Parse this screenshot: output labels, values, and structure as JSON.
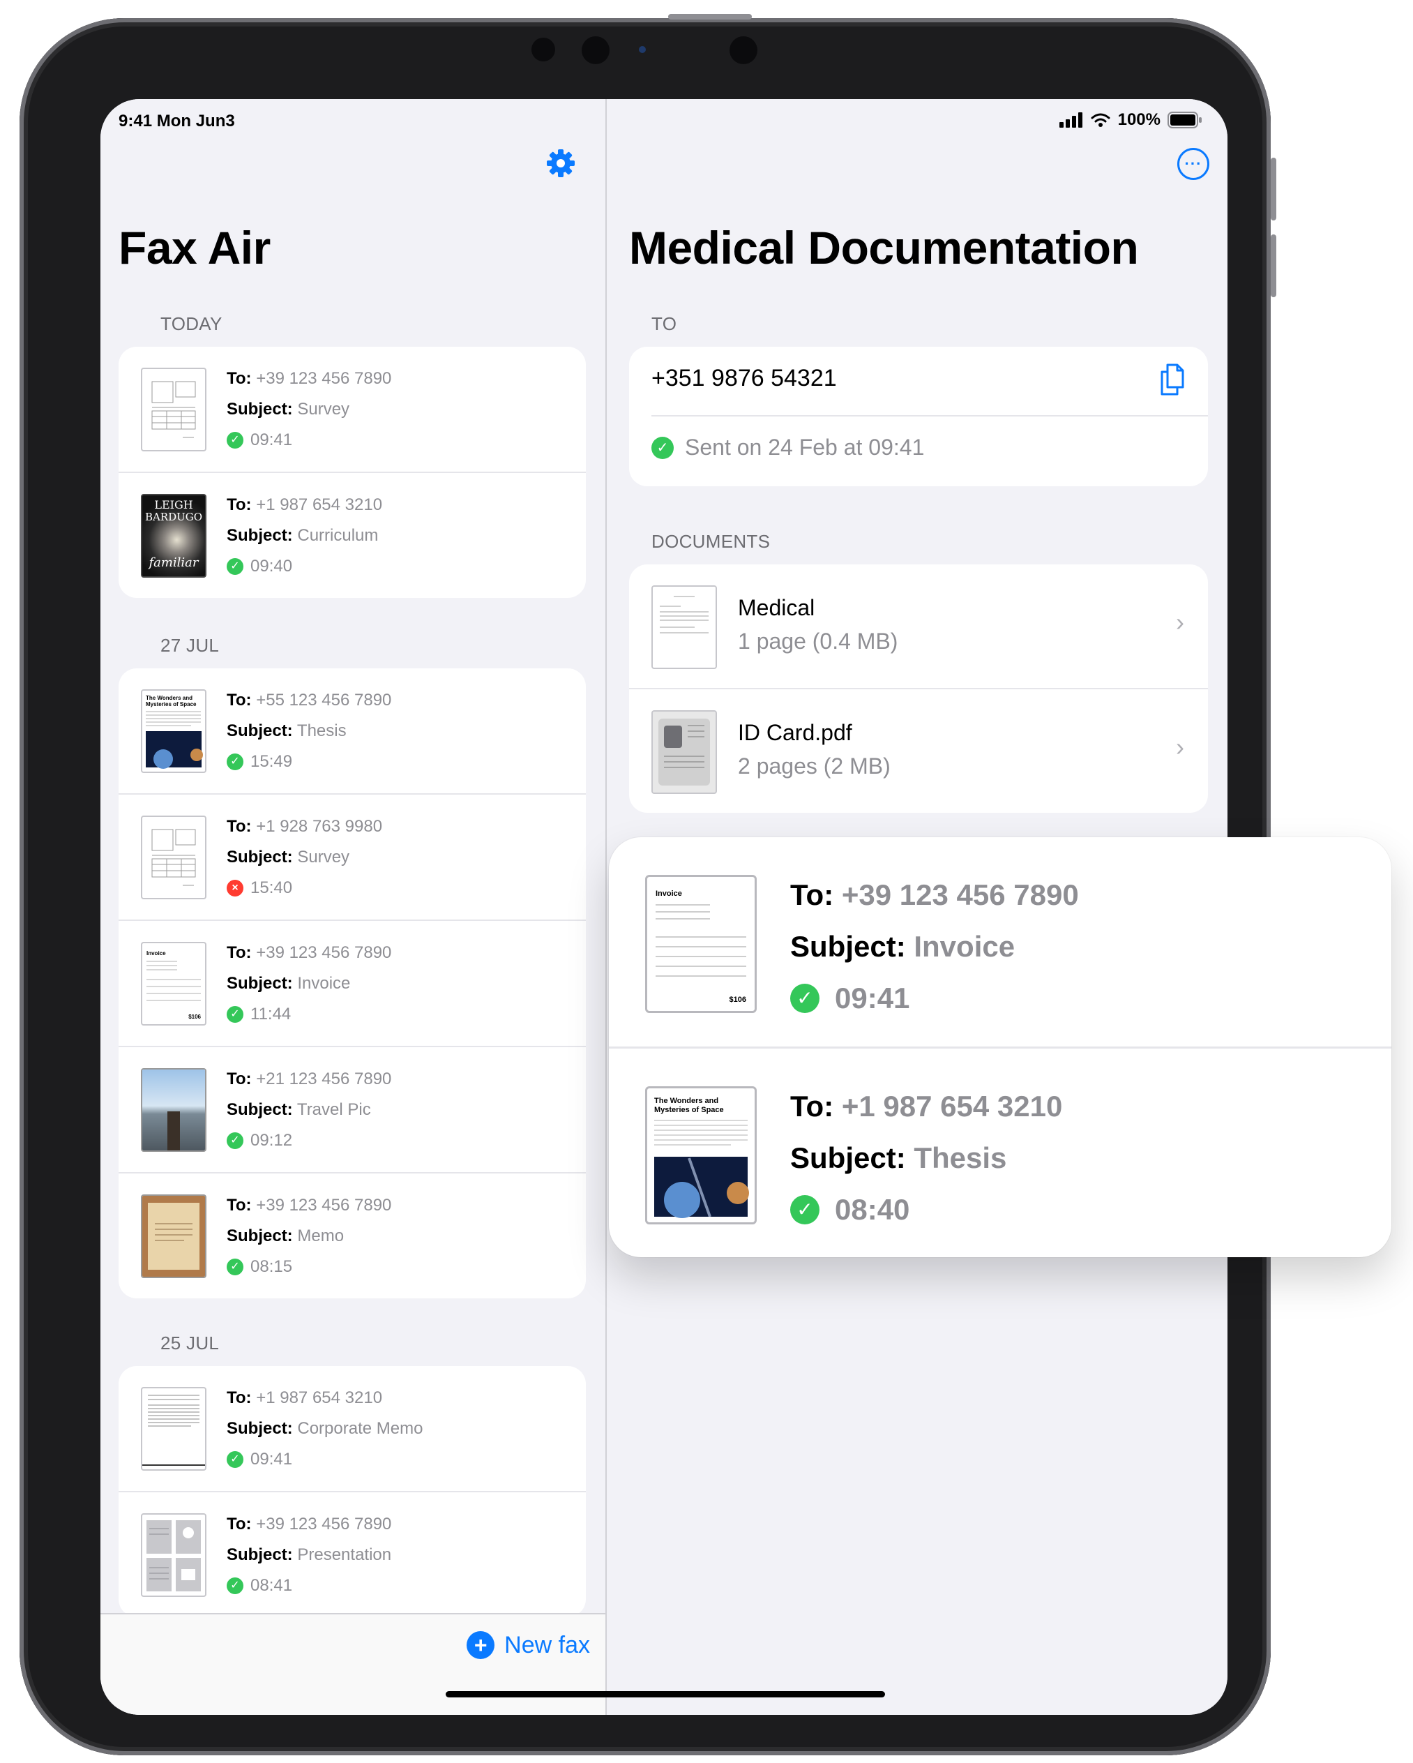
{
  "status_bar": {
    "time": "9:41  Mon Jun3",
    "battery": "100%"
  },
  "left": {
    "title": "Fax Air",
    "sections": [
      {
        "header": "TODAY",
        "items": [
          {
            "to_label": "To:",
            "to": "+39 123 456 7890",
            "subject_label": "Subject:",
            "subject": "Survey",
            "time": "09:41",
            "status": "sent"
          },
          {
            "to_label": "To:",
            "to": "+1 987 654 3210",
            "subject_label": "Subject:",
            "subject": "Curriculum",
            "time": "09:40",
            "status": "sent",
            "cover_top": "LEIGH",
            "cover_mid": "BARDUGO",
            "cover_bot": "familiar"
          }
        ]
      },
      {
        "header": "27 JUL",
        "items": [
          {
            "to_label": "To:",
            "to": "+55 123 456 7890",
            "subject_label": "Subject:",
            "subject": "Thesis",
            "time": "15:49",
            "status": "sent",
            "thumb_title": "The Wonders and Mysteries of Space"
          },
          {
            "to_label": "To:",
            "to": "+1 928 763 9980",
            "subject_label": "Subject:",
            "subject": "Survey",
            "time": "15:40",
            "status": "failed"
          },
          {
            "to_label": "To:",
            "to": "+39 123 456 7890",
            "subject_label": "Subject:",
            "subject": "Invoice",
            "time": "11:44",
            "status": "sent",
            "thumb_title": "Invoice",
            "thumb_total": "$106"
          },
          {
            "to_label": "To:",
            "to": "+21 123 456 7890",
            "subject_label": "Subject:",
            "subject": "Travel Pic",
            "time": "09:12",
            "status": "sent"
          },
          {
            "to_label": "To:",
            "to": "+39 123 456 7890",
            "subject_label": "Subject:",
            "subject": "Memo",
            "time": "08:15",
            "status": "sent"
          }
        ]
      },
      {
        "header": "25 JUL",
        "items": [
          {
            "to_label": "To:",
            "to": "+1 987 654 3210",
            "subject_label": "Subject:",
            "subject": "Corporate Memo",
            "time": "09:41",
            "status": "sent"
          },
          {
            "to_label": "To:",
            "to": "+39 123 456 7890",
            "subject_label": "Subject:",
            "subject": "Presentation",
            "time": "08:41",
            "status": "sent"
          }
        ]
      }
    ],
    "new_fax_label": "New fax"
  },
  "right": {
    "title": "Medical Documentation",
    "to_header": "TO",
    "to_number": "+351 9876 54321",
    "sent_status": "Sent on 24 Feb at 09:41",
    "documents_header": "DOCUMENTS",
    "documents": [
      {
        "name": "Medical",
        "meta": "1 page (0.4 MB)"
      },
      {
        "name": "ID Card.pdf",
        "meta": "2 pages (2 MB)"
      }
    ]
  },
  "popup": {
    "items": [
      {
        "to_label": "To:",
        "to": "+39 123 456 7890",
        "subject_label": "Subject:",
        "subject": "Invoice",
        "time": "09:41",
        "thumb_title": "Invoice",
        "thumb_total": "$106"
      },
      {
        "to_label": "To:",
        "to": "+1 987 654 3210",
        "subject_label": "Subject:",
        "subject": "Thesis",
        "time": "08:40",
        "thumb_title": "The Wonders and Mysteries of Space"
      }
    ]
  },
  "colors": {
    "accent": "#0a7aff",
    "success": "#34c759",
    "error": "#ff3b30",
    "background": "#f2f2f7"
  },
  "icons": [
    "gear-icon",
    "more-icon",
    "copy-icon",
    "checkmark-icon",
    "xmark-icon",
    "chevron-right-icon",
    "plus-icon",
    "wifi-icon",
    "cellular-icon",
    "battery-icon"
  ]
}
